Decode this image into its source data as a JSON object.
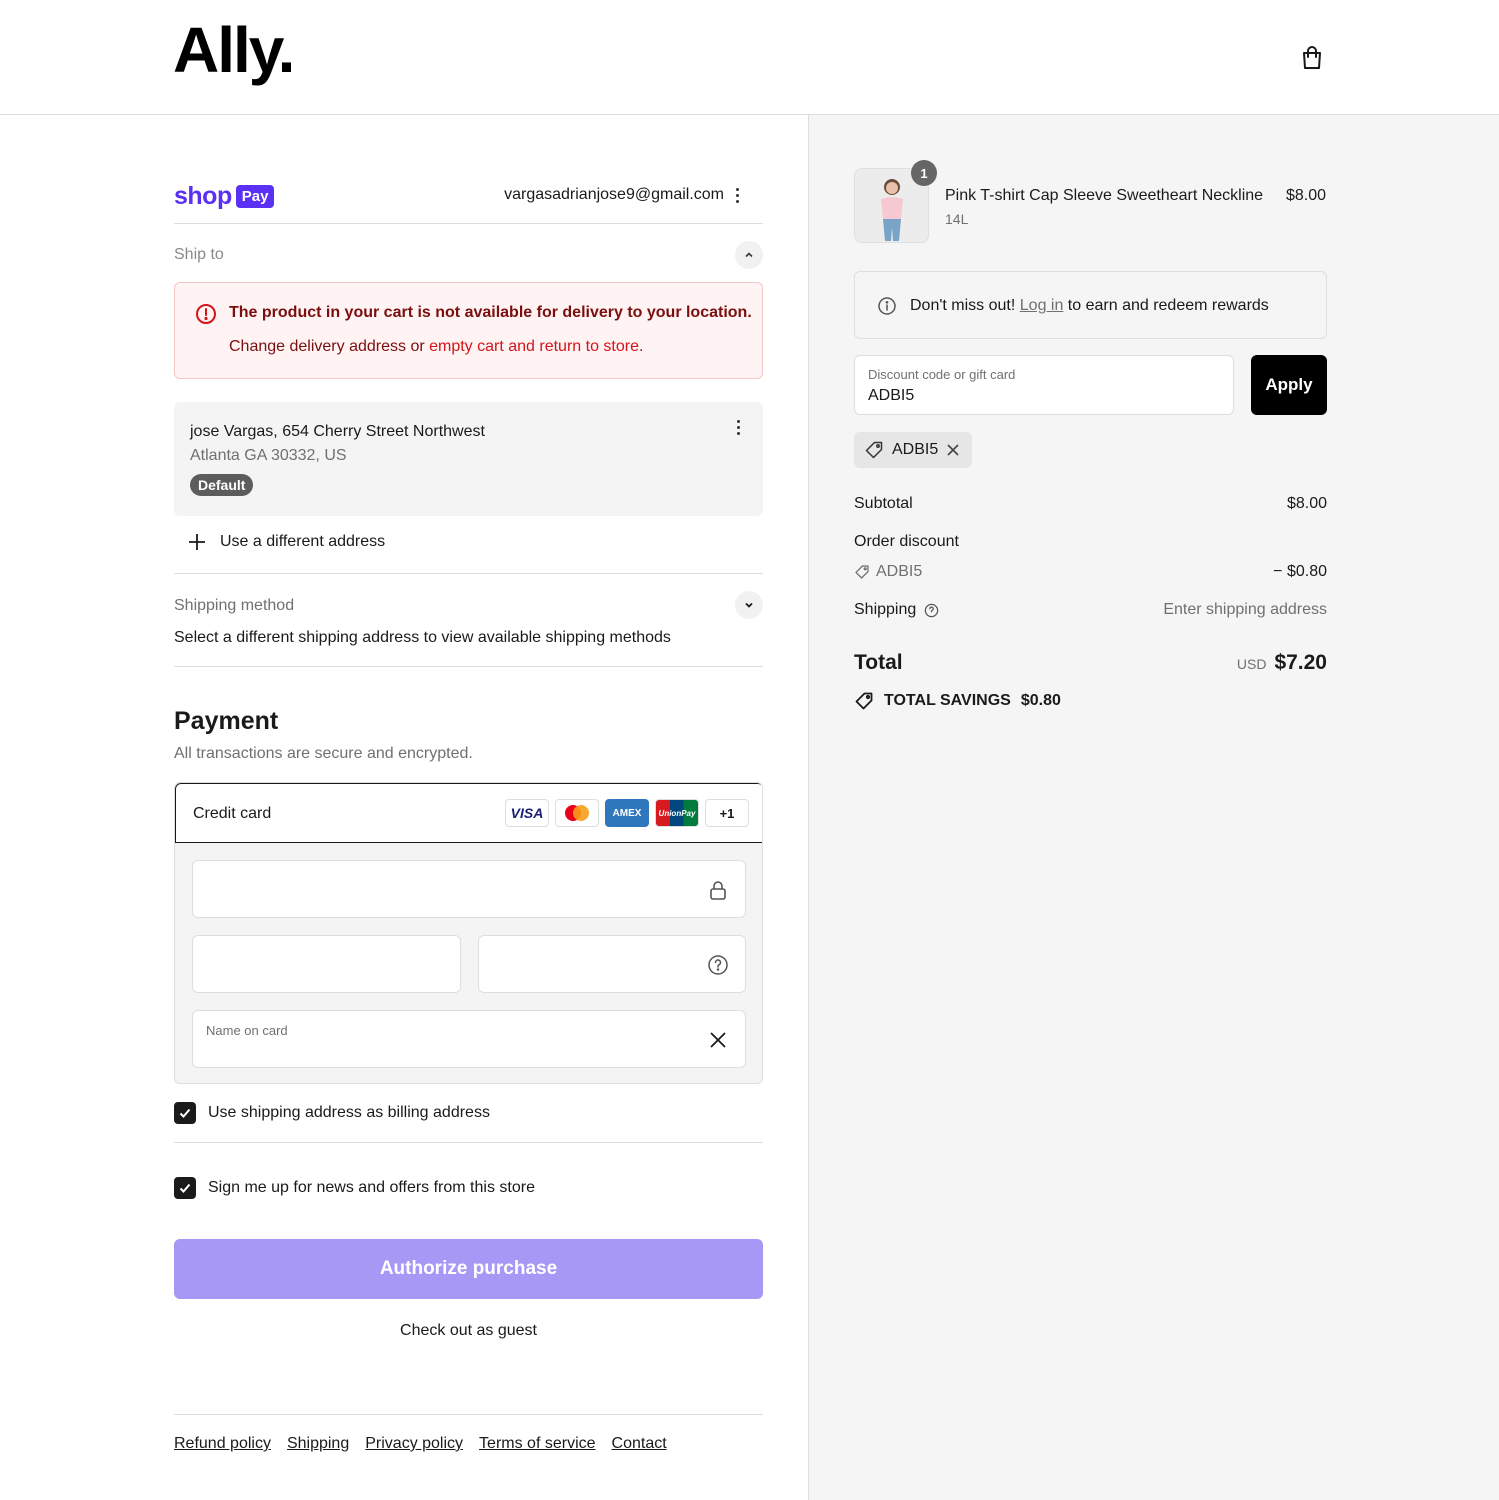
{
  "header": {
    "logo": "Ally."
  },
  "shop_pay": {
    "brand": "shop",
    "badge": "Pay",
    "email": "vargasadrianjose9@gmail.com"
  },
  "ship_to": {
    "label": "Ship to",
    "alert_title": "The product in your cart is not available for delivery to your location.",
    "alert_prefix": "Change delivery address or ",
    "alert_link": "empty cart and return to store",
    "alert_suffix": ".",
    "address_line1": "jose Vargas, 654 Cherry Street Northwest",
    "address_line2": "Atlanta GA 30332, US",
    "default_badge": "Default",
    "different_address": "Use a different address"
  },
  "shipping_method": {
    "label": "Shipping method",
    "note": "Select a different shipping address to view available shipping methods"
  },
  "payment": {
    "title": "Payment",
    "subtitle": "All transactions are secure and encrypted.",
    "credit_card_label": "Credit card",
    "card_logos": [
      "VISA",
      "mastercard",
      "AMEX",
      "UnionPay",
      "+1"
    ],
    "name_on_card_label": "Name on card",
    "billing_checkbox": "Use shipping address as billing address",
    "news_checkbox": "Sign me up for news and offers from this store",
    "authorize_button": "Authorize purchase",
    "guest_link": "Check out as guest"
  },
  "footer": {
    "links": [
      "Refund policy",
      "Shipping",
      "Privacy policy",
      "Terms of service",
      "Contact"
    ]
  },
  "summary": {
    "product": {
      "qty": "1",
      "name": "Pink T-shirt Cap Sleeve Sweetheart Neckline",
      "variant": "14L",
      "price": "$8.00"
    },
    "rewards_prefix": "Don't miss out! ",
    "rewards_link": "Log in",
    "rewards_suffix": " to earn and redeem rewards",
    "discount_label": "Discount code or gift card",
    "discount_value": "ADBI5",
    "apply_button": "Apply",
    "applied_code": "ADBI5",
    "subtotal_label": "Subtotal",
    "subtotal_value": "$8.00",
    "order_discount_label": "Order discount",
    "discount_code": "ADBI5",
    "discount_amount": "− $0.80",
    "shipping_label": "Shipping",
    "shipping_value": "Enter shipping address",
    "total_label": "Total",
    "currency": "USD",
    "total_value": "$7.20",
    "savings_label": "TOTAL SAVINGS",
    "savings_value": "$0.80"
  },
  "colors": {
    "shop_pay": "#5a31f4",
    "authorize": "#a898f5",
    "alert_red": "#d4141a"
  }
}
